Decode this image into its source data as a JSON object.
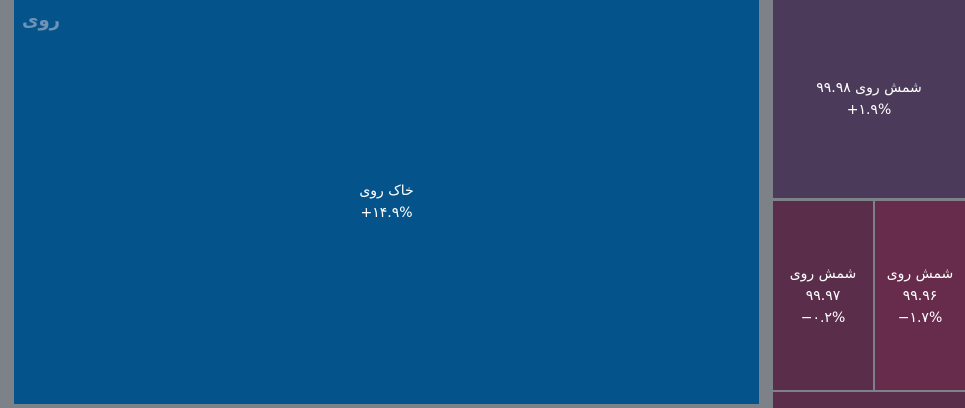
{
  "chart_data": {
    "type": "treemap",
    "group": "روی",
    "items": [
      {
        "label": "خاک روی",
        "change": "+۱۴.۹%",
        "value": 75.0,
        "color": "#04548b"
      },
      {
        "label": "شمش روی ۹۹.۹۸",
        "change": "+۱.۹%",
        "value": 8.6,
        "color": "#4b3a5a"
      },
      {
        "label": "شمش روی ۹۹.۹۷",
        "change": "−۰.۲%",
        "value": 4.45,
        "color": "#5a2d4b"
      },
      {
        "label": "شمش روی ۹۹.۹۶",
        "change": "−۱.۷%",
        "value": 4.05,
        "color": "#672b4c"
      },
      {
        "label": "",
        "change": "",
        "value": 0.8,
        "color": "#5a2d4b"
      }
    ]
  }
}
